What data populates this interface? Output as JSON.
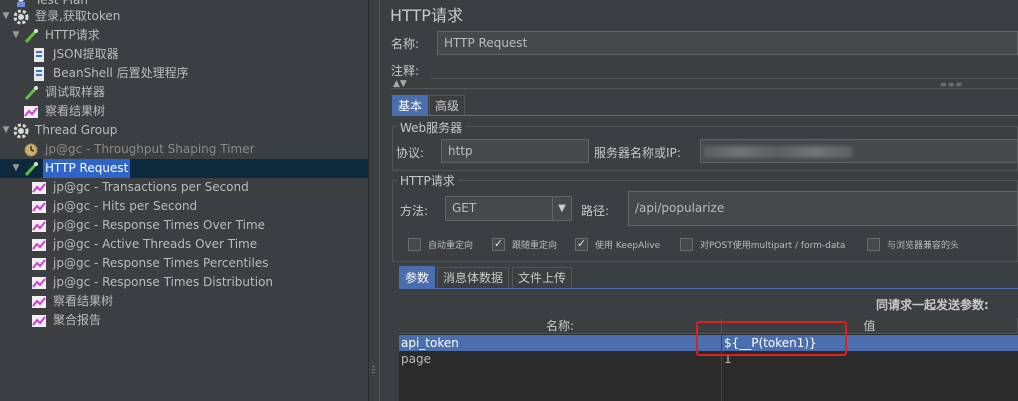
{
  "tree": {
    "items": [
      {
        "label": "Test Plan",
        "icon": "test-plan-icon",
        "toggle": ""
      },
      {
        "label": "登录,获取token",
        "icon": "gear-icon",
        "toggle": "▼"
      },
      {
        "label": "HTTP请求",
        "icon": "pipette-icon",
        "toggle": "▼"
      },
      {
        "label": "JSON提取器",
        "icon": "script-icon",
        "toggle": ""
      },
      {
        "label": "BeanShell 后置处理程序",
        "icon": "script-icon",
        "toggle": ""
      },
      {
        "label": "调试取样器",
        "icon": "pipette-icon",
        "toggle": ""
      },
      {
        "label": "察看结果树",
        "icon": "graph-icon",
        "toggle": ""
      },
      {
        "label": "Thread Group",
        "icon": "gear-icon",
        "toggle": "▼"
      },
      {
        "label": "jp@gc - Throughput Shaping Timer",
        "icon": "timer-icon",
        "toggle": ""
      },
      {
        "label": "HTTP Request",
        "icon": "pipette-icon",
        "toggle": "▼"
      },
      {
        "label": "jp@gc - Transactions per Second",
        "icon": "graph-icon",
        "toggle": ""
      },
      {
        "label": "jp@gc - Hits per Second",
        "icon": "graph-icon",
        "toggle": ""
      },
      {
        "label": "jp@gc - Response Times Over Time",
        "icon": "graph-icon",
        "toggle": ""
      },
      {
        "label": "jp@gc - Active Threads Over Time",
        "icon": "graph-icon",
        "toggle": ""
      },
      {
        "label": "jp@gc - Response Times Percentiles",
        "icon": "graph-icon",
        "toggle": ""
      },
      {
        "label": "jp@gc - Response Times Distribution",
        "icon": "graph-icon",
        "toggle": ""
      },
      {
        "label": "察看结果树",
        "icon": "graph-icon",
        "toggle": ""
      },
      {
        "label": "聚合报告",
        "icon": "graph-icon",
        "toggle": ""
      }
    ]
  },
  "panel": {
    "title": "HTTP请求",
    "name_label": "名称:",
    "name_value": "HTTP Request",
    "comment_label": "注释:",
    "tabs": [
      "基本",
      "高级"
    ],
    "web_server_title": "Web服务器",
    "protocol_label": "协议:",
    "protocol_value": "http",
    "server_label": "服务器名称或IP:",
    "http_request_title": "HTTP请求",
    "method_label": "方法:",
    "method_value": "GET",
    "path_label": "路径:",
    "path_value": "/api/popularize",
    "checkboxes": [
      {
        "label": "自动重定向",
        "checked": false
      },
      {
        "label": "跟随重定向",
        "checked": true
      },
      {
        "label": "使用 KeepAlive",
        "checked": true
      },
      {
        "label": "对POST使用multipart / form-data",
        "checked": false
      },
      {
        "label": "与浏览器兼容的头",
        "checked": false
      }
    ],
    "sub_tabs": [
      "参数",
      "消息体数据",
      "文件上传"
    ],
    "send_params_label": "同请求一起发送参数:",
    "table": {
      "headers": [
        "名称:",
        "值"
      ],
      "rows": [
        {
          "name": "api_token",
          "value": "${__P(token1)}"
        },
        {
          "name": "page",
          "value": "1"
        }
      ]
    }
  },
  "colors": {
    "accent": "#4b6eaf",
    "highlight": "#e0201a",
    "tree_selection": "#2f65ca"
  }
}
